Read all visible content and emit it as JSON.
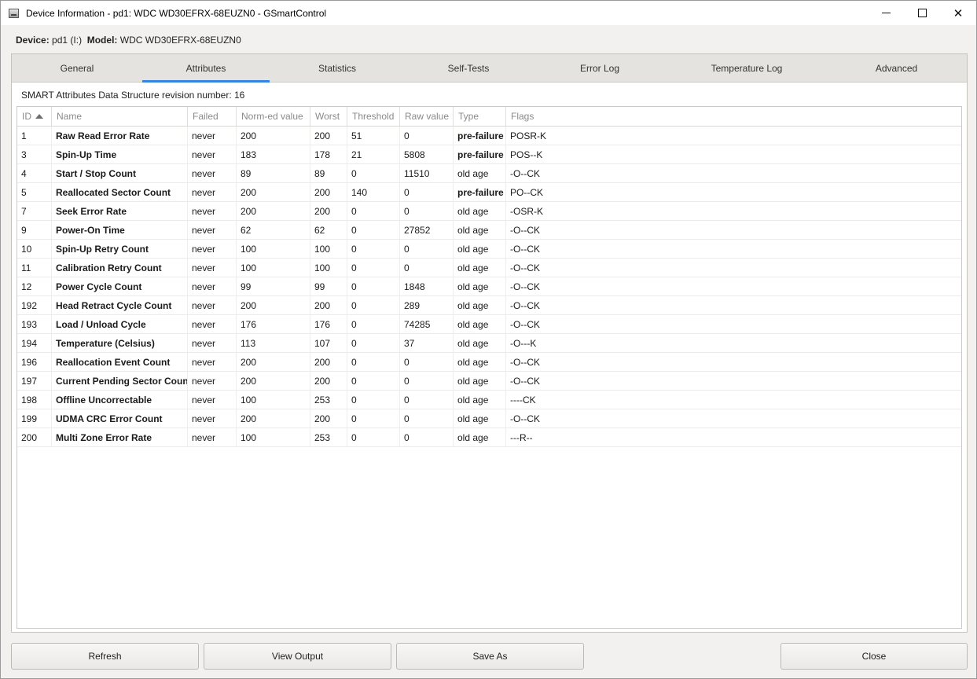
{
  "window": {
    "title": "Device Information - pd1: WDC WD30EFRX-68EUZN0 - GSmartControl",
    "controls": {
      "minimize": "—",
      "close": "✕"
    }
  },
  "device": {
    "device_label": "Device:",
    "device_value": "pd1 (I:)",
    "model_label": "Model:",
    "model_value": "WDC WD30EFRX-68EUZN0"
  },
  "tabs": [
    {
      "label": "General"
    },
    {
      "label": "Attributes",
      "active": true
    },
    {
      "label": "Statistics"
    },
    {
      "label": "Self-Tests"
    },
    {
      "label": "Error Log"
    },
    {
      "label": "Temperature Log"
    },
    {
      "label": "Advanced"
    }
  ],
  "attributes": {
    "revision_text": "SMART Attributes Data Structure revision number: 16",
    "columns": [
      "ID",
      "Name",
      "Failed",
      "Norm-ed value",
      "Worst",
      "Threshold",
      "Raw value",
      "Type",
      "Flags"
    ],
    "rows": [
      {
        "id": "1",
        "name": "Raw Read Error Rate",
        "failed": "never",
        "norm": "200",
        "worst": "200",
        "threshold": "51",
        "raw": "0",
        "type": "pre-failure",
        "flags": "POSR-K"
      },
      {
        "id": "3",
        "name": "Spin-Up Time",
        "failed": "never",
        "norm": "183",
        "worst": "178",
        "threshold": "21",
        "raw": "5808",
        "type": "pre-failure",
        "flags": "POS--K"
      },
      {
        "id": "4",
        "name": "Start / Stop Count",
        "failed": "never",
        "norm": "89",
        "worst": "89",
        "threshold": "0",
        "raw": "11510",
        "type": "old age",
        "flags": "-O--CK"
      },
      {
        "id": "5",
        "name": "Reallocated Sector Count",
        "failed": "never",
        "norm": "200",
        "worst": "200",
        "threshold": "140",
        "raw": "0",
        "type": "pre-failure",
        "flags": "PO--CK"
      },
      {
        "id": "7",
        "name": "Seek Error Rate",
        "failed": "never",
        "norm": "200",
        "worst": "200",
        "threshold": "0",
        "raw": "0",
        "type": "old age",
        "flags": "-OSR-K"
      },
      {
        "id": "9",
        "name": "Power-On Time",
        "failed": "never",
        "norm": "62",
        "worst": "62",
        "threshold": "0",
        "raw": "27852",
        "type": "old age",
        "flags": "-O--CK"
      },
      {
        "id": "10",
        "name": "Spin-Up Retry Count",
        "failed": "never",
        "norm": "100",
        "worst": "100",
        "threshold": "0",
        "raw": "0",
        "type": "old age",
        "flags": "-O--CK"
      },
      {
        "id": "11",
        "name": "Calibration Retry Count",
        "failed": "never",
        "norm": "100",
        "worst": "100",
        "threshold": "0",
        "raw": "0",
        "type": "old age",
        "flags": "-O--CK"
      },
      {
        "id": "12",
        "name": "Power Cycle Count",
        "failed": "never",
        "norm": "99",
        "worst": "99",
        "threshold": "0",
        "raw": "1848",
        "type": "old age",
        "flags": "-O--CK"
      },
      {
        "id": "192",
        "name": "Head Retract Cycle Count",
        "failed": "never",
        "norm": "200",
        "worst": "200",
        "threshold": "0",
        "raw": "289",
        "type": "old age",
        "flags": "-O--CK"
      },
      {
        "id": "193",
        "name": "Load / Unload Cycle",
        "failed": "never",
        "norm": "176",
        "worst": "176",
        "threshold": "0",
        "raw": "74285",
        "type": "old age",
        "flags": "-O--CK"
      },
      {
        "id": "194",
        "name": "Temperature (Celsius)",
        "failed": "never",
        "norm": "113",
        "worst": "107",
        "threshold": "0",
        "raw": "37",
        "type": "old age",
        "flags": "-O---K"
      },
      {
        "id": "196",
        "name": "Reallocation Event Count",
        "failed": "never",
        "norm": "200",
        "worst": "200",
        "threshold": "0",
        "raw": "0",
        "type": "old age",
        "flags": "-O--CK"
      },
      {
        "id": "197",
        "name": "Current Pending Sector Count",
        "failed": "never",
        "norm": "200",
        "worst": "200",
        "threshold": "0",
        "raw": "0",
        "type": "old age",
        "flags": "-O--CK"
      },
      {
        "id": "198",
        "name": "Offline Uncorrectable",
        "failed": "never",
        "norm": "100",
        "worst": "253",
        "threshold": "0",
        "raw": "0",
        "type": "old age",
        "flags": "----CK"
      },
      {
        "id": "199",
        "name": "UDMA CRC Error Count",
        "failed": "never",
        "norm": "200",
        "worst": "200",
        "threshold": "0",
        "raw": "0",
        "type": "old age",
        "flags": "-O--CK"
      },
      {
        "id": "200",
        "name": "Multi Zone Error Rate",
        "failed": "never",
        "norm": "100",
        "worst": "253",
        "threshold": "0",
        "raw": "0",
        "type": "old age",
        "flags": "---R--"
      }
    ]
  },
  "buttons": {
    "refresh": "Refresh",
    "view_output": "View Output",
    "save_as": "Save As",
    "close": "Close"
  },
  "colors": {
    "accent": "#3584e4",
    "tabbar_bg": "#e5e3e0",
    "window_bg": "#f2f1f0"
  }
}
